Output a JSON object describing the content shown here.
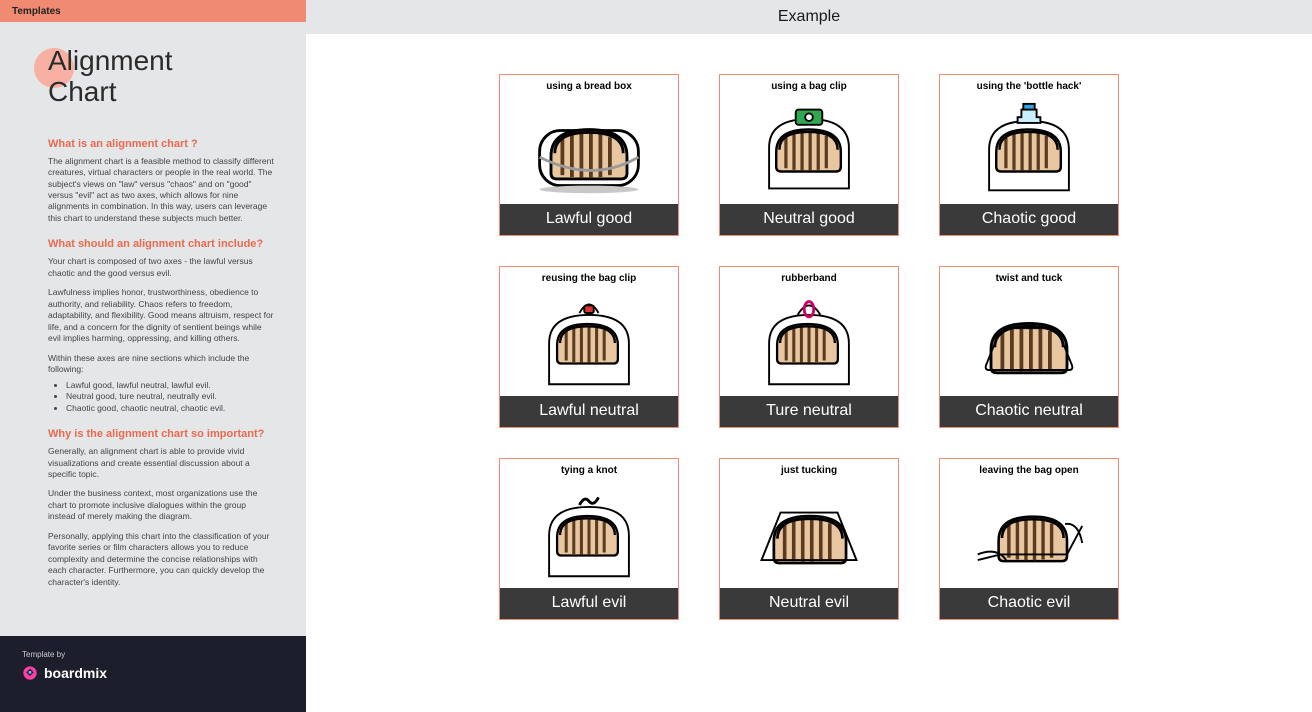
{
  "sidebar": {
    "tab": "Templates",
    "title": "Alignment\nChart",
    "sections": {
      "s1": {
        "heading": "What is an alignment chart ?",
        "p1": "The alignment chart is a feasible method to classify different creatures, virtual characters or people in the real world. The subject's views on \"law\" versus \"chaos\" and on \"good\" versus \"evil\" act as two axes, which allows for nine alignments in combination. In this way, users can leverage this chart to understand these subjects much better."
      },
      "s2": {
        "heading": "What should an alignment chart include?",
        "p1": "Your chart is composed of two axes - the lawful versus chaotic and the good versus evil.",
        "p2": "Lawfulness implies honor, trustworthiness, obedience to authority, and reliability. Chaos refers to freedom, adaptability, and flexibility. Good means altruism, respect for life, and a concern for the dignity of sentient beings while evil implies harming, oppressing, and killing others.",
        "p3": "Within these axes are nine sections which include the following:",
        "li1": "Lawful good, lawful neutral, lawful evil.",
        "li2": "Neutral good, ture neutral, neutrally evil.",
        "li3": "Chaotic good, chaotic neutral, chaotic evil."
      },
      "s3": {
        "heading": "Why is the alignment chart so important?",
        "p1": "Generally, an alignment chart is able to provide vivid visualizations and create essential discussion about a specific topic.",
        "p2": "Under the business context, most organizations use the chart to promote inclusive dialogues within the group instead of merely making the diagram.",
        "p3": "Personally, applying this chart into the classification of your favorite series or film characters allows you to reduce complexity and determine the concise relationships with each character. Furthermore, you can quickly develop the character's identity."
      }
    },
    "footer": {
      "byline": "Template by",
      "brand": "boardmix"
    }
  },
  "main": {
    "title": "Example",
    "cells": [
      {
        "caption": "using a bread box",
        "label": "Lawful good",
        "icon": "breadbox"
      },
      {
        "caption": "using a bag clip",
        "label": "Neutral good",
        "icon": "bagclip"
      },
      {
        "caption": "using the 'bottle hack'",
        "label": "Chaotic good",
        "icon": "bottlehack"
      },
      {
        "caption": "reusing the bag clip",
        "label": "Lawful neutral",
        "icon": "reuseclip"
      },
      {
        "caption": "rubberband",
        "label": "Ture neutral",
        "icon": "rubberband"
      },
      {
        "caption": "twist and tuck",
        "label": "Chaotic neutral",
        "icon": "twisttuck"
      },
      {
        "caption": "tying a knot",
        "label": "Lawful evil",
        "icon": "knot"
      },
      {
        "caption": "just tucking",
        "label": "Neutral evil",
        "icon": "tucking"
      },
      {
        "caption": "leaving the bag open",
        "label": "Chaotic evil",
        "icon": "open"
      }
    ]
  },
  "chart_data": {
    "type": "table",
    "title": "Alignment Chart — bread storage methods",
    "axes": {
      "rows": [
        "Good",
        "Neutral",
        "Evil"
      ],
      "cols": [
        "Lawful",
        "Neutral",
        "Chaotic"
      ]
    },
    "grid": [
      [
        "using a bread box",
        "using a bag clip",
        "using the 'bottle hack'"
      ],
      [
        "reusing the bag clip",
        "rubberband",
        "twist and tuck"
      ],
      [
        "tying a knot",
        "just tucking",
        "leaving the bag open"
      ]
    ],
    "labels": [
      [
        "Lawful good",
        "Neutral good",
        "Chaotic good"
      ],
      [
        "Lawful neutral",
        "Ture neutral",
        "Chaotic neutral"
      ],
      [
        "Lawful evil",
        "Neutral evil",
        "Chaotic evil"
      ]
    ]
  }
}
